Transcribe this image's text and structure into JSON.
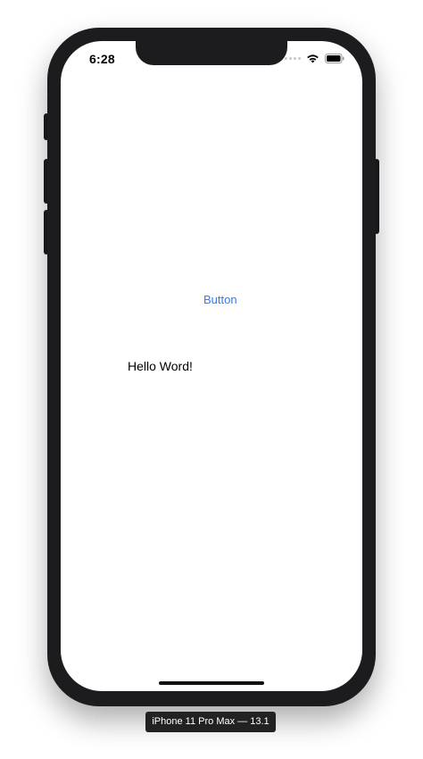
{
  "status_bar": {
    "time": "6:28"
  },
  "icons": {
    "signal": "cellular-signal-icon",
    "wifi": "wifi-icon",
    "battery": "battery-icon"
  },
  "content": {
    "button_label": "Button",
    "hello_text": "Hello Word!"
  },
  "device": {
    "caption": "iPhone 11 Pro Max — 13.1"
  },
  "colors": {
    "accent": "#2f7cf6",
    "frame": "#1c1c1e",
    "screen": "#ffffff"
  }
}
